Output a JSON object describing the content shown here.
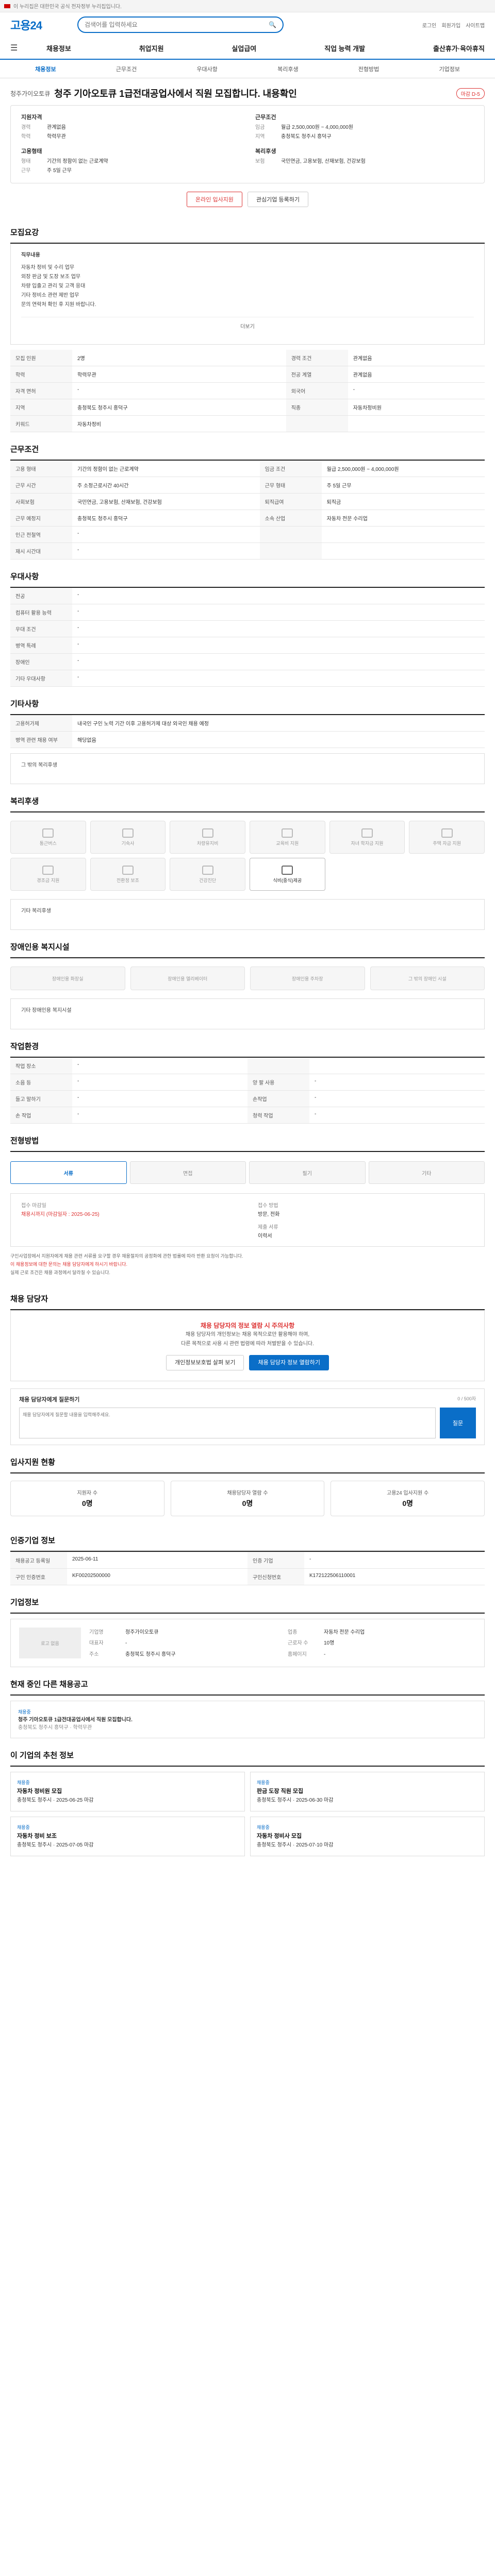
{
  "topbar": {
    "notice": "이 누리집은 대한민국 공식 전자정부 누리집입니다."
  },
  "header": {
    "logo": "고용24",
    "search_placeholder": "검색어를 입력하세요",
    "util": [
      "로그인",
      "회원가입",
      "사이트맵"
    ]
  },
  "gnb": [
    "채용정보",
    "취업지원",
    "실업급여",
    "직업 능력 개발",
    "출산휴가·육아휴직"
  ],
  "subtabs": [
    "채용정보",
    "근무조건",
    "우대사항",
    "복리후생",
    "전형방법",
    "기업정보"
  ],
  "job": {
    "company": "청주가이오토큐",
    "title": "청주 기아오토큐 1급전대공업사에서 직원 모집합니다. 내용확인",
    "status": "마감 D-5",
    "summary": {
      "qual_title": "지원자격",
      "qual": [
        {
          "k": "경력",
          "v": "관계없음"
        },
        {
          "k": "학력",
          "v": "학력무관"
        }
      ],
      "cond_title": "근무조건",
      "cond": [
        {
          "k": "임금",
          "v": "월급 2,500,000원 ~ 4,000,000원"
        },
        {
          "k": "지역",
          "v": "충청북도 청주시 흥덕구"
        }
      ],
      "corp_title": "고용형태",
      "corp": [
        {
          "k": "형태",
          "v": "기간의 정함이 없는 근로계약"
        },
        {
          "k": "근무",
          "v": "주 5일 근무"
        }
      ],
      "duty_title": "복리후생",
      "duty": [
        {
          "k": "보험",
          "v": "국민연금, 고용보험, 산재보험, 건강보험"
        }
      ]
    },
    "btn_apply": "온라인 입사지원",
    "btn_interest": "관심기업 등록하기"
  },
  "sections": {
    "recruit": "모집요강",
    "work": "근무조건",
    "pref": "우대사항",
    "etc": "기타사항",
    "welfare": "복리후생",
    "disability": "장애인용 복지시설",
    "env": "작업환경",
    "method": "전형방법",
    "contact": "채용 담당자",
    "status": "입사지원 현황",
    "reg": "인증기업 정보",
    "corp": "기업정보",
    "other": "현재 중인 다른 채용공고",
    "similar": "이 기업의 추천 정보"
  },
  "recruit_box": {
    "title": "직무내용",
    "lines": [
      "자동차 정비 및 수리 업무",
      "외장 판금 및 도장 보조 업무",
      "차량 입출고 관리 및 고객 응대",
      "기타 정비소 관련 제반 업무",
      "문의 연락처 확인 후 지원 바랍니다."
    ],
    "more": "더보기"
  },
  "recruit_table": [
    {
      "k": "모집 인원",
      "v": "2명",
      "k2": "경력 조건",
      "v2": "관계없음"
    },
    {
      "k": "학력",
      "v": "학력무관",
      "k2": "전공 계열",
      "v2": "관계없음"
    },
    {
      "k": "자격 면허",
      "v": "-",
      "k2": "외국어",
      "v2": "-"
    },
    {
      "k": "지역",
      "v": "충청북도 청주시 흥덕구",
      "k2": "직종",
      "v2": "자동차정비원"
    },
    {
      "k": "키워드",
      "v": "자동차정비",
      "k2": "",
      "v2": ""
    }
  ],
  "work_table": [
    {
      "k": "고용 형태",
      "v": "기간의 정함이 없는 근로계약",
      "k2": "임금 조건",
      "v2": "월급 2,500,000원 ~ 4,000,000원"
    },
    {
      "k": "근무 시간",
      "v": "주 소정근로시간 40시간",
      "k2": "근무 형태",
      "v2": "주 5일 근무"
    },
    {
      "k": "사회보험",
      "v": "국민연금, 고용보험, 산재보험, 건강보험",
      "k2": "퇴직급여",
      "v2": "퇴직금"
    },
    {
      "k": "근무 예정지",
      "v": "충청북도 청주시 흥덕구",
      "k2": "소속 산업",
      "v2": "자동차 전문 수리업"
    },
    {
      "k": "인근 전철역",
      "v": "-",
      "k2": "",
      "v2": ""
    },
    {
      "k": "재시 시간대",
      "v": "-",
      "k2": "",
      "v2": ""
    }
  ],
  "pref_table": [
    {
      "k": "전공",
      "v": "-"
    },
    {
      "k": "컴퓨터 활용 능력",
      "v": "-"
    },
    {
      "k": "우대 조건",
      "v": "-"
    },
    {
      "k": "병역 특례",
      "v": "-"
    },
    {
      "k": "장애인",
      "v": "-"
    },
    {
      "k": "기타 우대사항",
      "v": "-"
    }
  ],
  "etc_table": [
    {
      "k": "고용허가제",
      "v": "내국인 구인 노력 기간 이후 고용허가제 대상 외국인 채용 예정"
    },
    {
      "k": "병역 관련 채용 여부",
      "v": "해당없음"
    }
  ],
  "etc_note": "그 밖의 복리후생",
  "welfare_items": [
    "통근버스",
    "기숙사",
    "차량유지비",
    "교육비 지원",
    "자녀 학자금 지원",
    "주택 자금 지원",
    "경조금 지원",
    "전환정 보조",
    "건강진단",
    "식비(중식)제공"
  ],
  "welfare_on_index": 9,
  "welfare_note": "기타 복리후생",
  "disability_items": [
    "장애인용 화장실",
    "장애인용 엘리베이터",
    "장애인용 주차장",
    "그 밖의 장애인 시설"
  ],
  "disability_note": "기타 장애인용 복지시설",
  "env_table": [
    {
      "k": "작업 장소",
      "v": "-",
      "k2": "",
      "v2": ""
    },
    {
      "k": "소음 등",
      "v": "-",
      "k2": "양 팔 사용",
      "v2": "-"
    },
    {
      "k": "들고 말하기",
      "v": "-",
      "k2": "손작업",
      "v2": "-"
    },
    {
      "k": "손 작업",
      "v": "-",
      "k2": "청력 작업",
      "v2": "-"
    }
  ],
  "method_steps": [
    "서류",
    "면접",
    "필기",
    "기타"
  ],
  "apply": {
    "k1": "접수 마감일",
    "v1": "채용시까지 (마감일자 : 2025-06-25)",
    "k2": "접수 방법",
    "v2": "방문, 전화",
    "k3": "제출 서류",
    "v3": "이력서"
  },
  "apply_notes": [
    "구인사업장에서 지원자에게 채용 관련 서류를 요구할 경우 채용절차의 공정화에 관한 법률에 따라 반환 요청이 가능합니다.",
    "이 채용정보에 대한 문의는 채용 담당자에게 하시기 바랍니다.",
    "실제 근로 조건은 채용 과정에서 달라질 수 있습니다."
  ],
  "contact": {
    "title": "채용 담당자의 정보 열람 시 주의사항",
    "lines": [
      "채용 담당자의 개인정보는 채용 목적으로만 활용해야 하며,",
      "다른 목적으로 사용 시 관련 법령에 따라 처벌받을 수 있습니다."
    ],
    "btn1": "개인정보보호법 살펴 보기",
    "btn2": "채용 담당자 정보 열람하기"
  },
  "qa": {
    "title": "채용 담당자에게 질문하기",
    "right": "0 / 500자",
    "placeholder": "채용 담당자에게 질문할 내용을 입력해주세요.",
    "send": "질문"
  },
  "stats": [
    {
      "k": "지원자 수",
      "v": "0명"
    },
    {
      "k": "채용담당자 열람 수",
      "v": "0명"
    },
    {
      "k": "고용24 입사지원 수",
      "v": "0명"
    }
  ],
  "reg_table": [
    {
      "k": "채용공고 등록일",
      "v": "2025-06-11"
    },
    {
      "k": "인증 기업",
      "v": "-"
    },
    {
      "k": "구인 인증번호",
      "v": "KF00202500000"
    },
    {
      "k": "구인신청번호",
      "v": "K172122506110001"
    }
  ],
  "corp": {
    "logo_text": "로고 없음",
    "fields": [
      {
        "k": "기업명",
        "v": "청주가이오토큐"
      },
      {
        "k": "업종",
        "v": "자동차 전문 수리업"
      },
      {
        "k": "대표자",
        "v": "-"
      },
      {
        "k": "근로자 수",
        "v": "10명"
      },
      {
        "k": "주소",
        "v": "충청북도 청주시 흥덕구"
      },
      {
        "k": "홈페이지",
        "v": "-"
      }
    ]
  },
  "other_job": {
    "tag": "채용중",
    "title": "청주 기아오토큐 1급전대공업사에서 직원 모집합니다.",
    "sub": "충청북도 청주시 흥덕구 · 학력무관"
  },
  "similar_jobs": [
    {
      "tag": "채용중",
      "title": "자동차 정비원 모집",
      "meta": "충청북도 청주시 · 2025-06-25 마감"
    },
    {
      "tag": "채용중",
      "title": "판금 도장 직원 모집",
      "meta": "충청북도 청주시 · 2025-06-30 마감"
    },
    {
      "tag": "채용중",
      "title": "자동차 정비 보조",
      "meta": "충청북도 청주시 · 2025-07-05 마감"
    },
    {
      "tag": "채용중",
      "title": "자동차 정비사 모집",
      "meta": "충청북도 청주시 · 2025-07-10 마감"
    }
  ]
}
